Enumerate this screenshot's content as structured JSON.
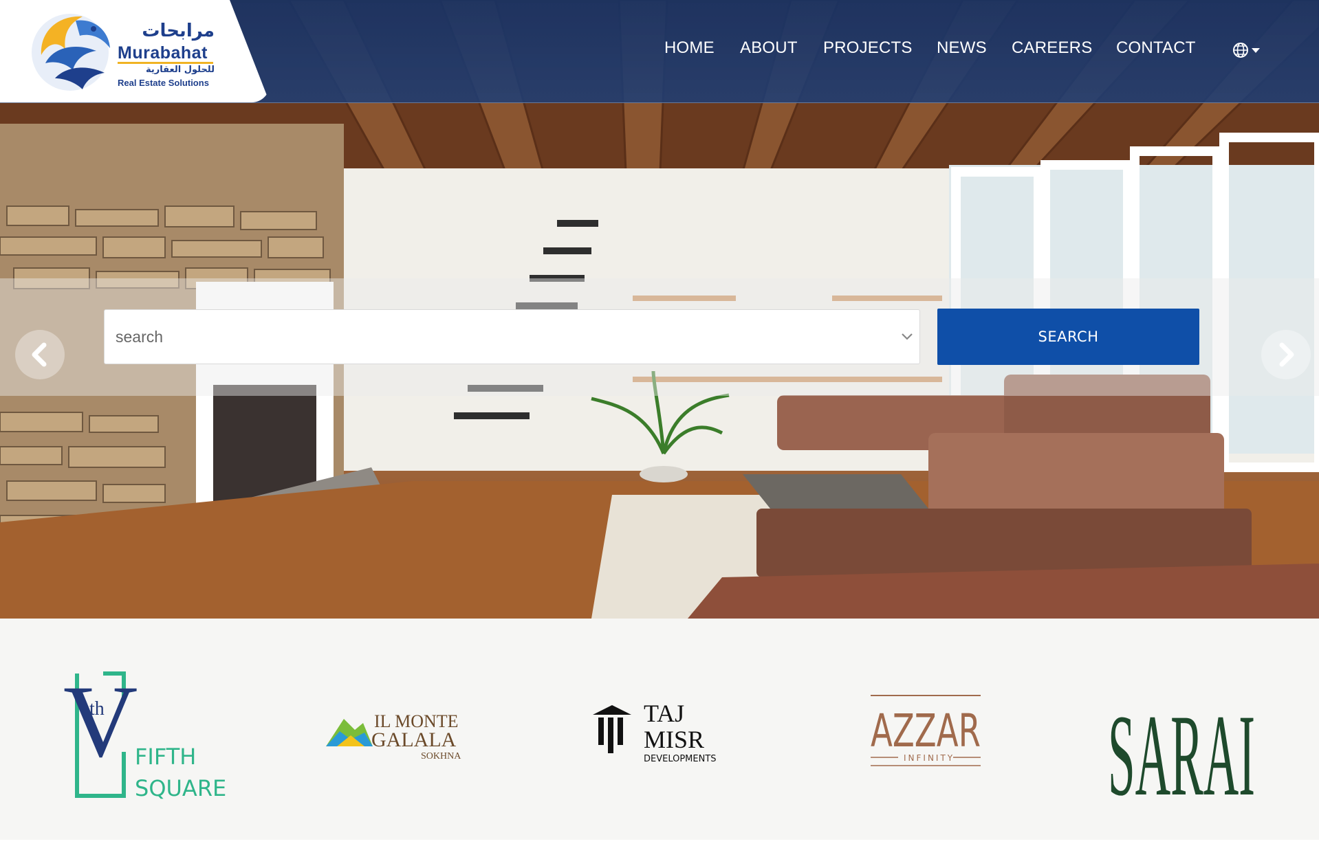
{
  "brand": {
    "arabic_name": "مرابحات",
    "name": "Murabahat",
    "arabic_tagline": "للحلول العقارية",
    "tagline": "Real Estate Solutions"
  },
  "nav": {
    "items": [
      {
        "label": "HOME"
      },
      {
        "label": "ABOUT"
      },
      {
        "label": "PROJECTS"
      },
      {
        "label": "NEWS"
      },
      {
        "label": "CAREERS"
      },
      {
        "label": "CONTACT"
      }
    ],
    "language_icon": "globe-icon"
  },
  "search": {
    "placeholder": "search",
    "button_label": "SEARCH"
  },
  "carousel": {
    "prev_icon": "chevron-left-icon",
    "next_icon": "chevron-right-icon"
  },
  "partners": {
    "fifth_square": {
      "numeral": "V",
      "superscript": "th",
      "line1": "FIFTH",
      "line2": "SQUARE"
    },
    "il_monte_galala": {
      "line1": "IL MONTE",
      "line2": "GALALA",
      "line3": "SOKHNA"
    },
    "taj_misr": {
      "line1": "TAJ",
      "line2": "MISR",
      "line3": "DEVELOPMENTS"
    },
    "azzar": {
      "line1": "AZZAR",
      "line2": "INFINITY"
    },
    "sarai": {
      "line1": "SARAI"
    }
  },
  "colors": {
    "header_blue": "#1e3e76",
    "brand_blue": "#1e3f8c",
    "brand_gold": "#f0b323",
    "search_button": "#0f4fa8",
    "fifth_square_green": "#2fb58a",
    "sarai_green": "#1e4a2c",
    "azzar_bronze": "#a06a4c"
  }
}
